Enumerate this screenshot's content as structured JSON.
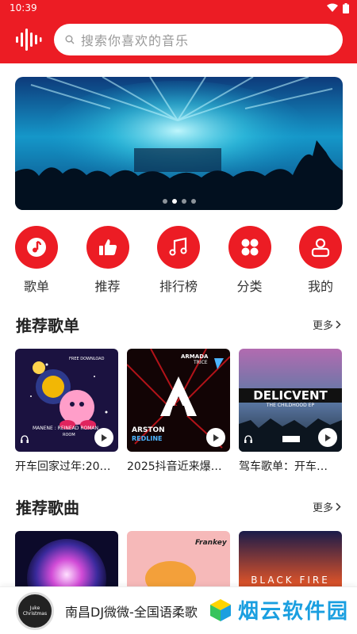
{
  "status": {
    "time": "10:39"
  },
  "header": {
    "search_placeholder": "搜索你喜欢的音乐"
  },
  "banner": {
    "dots": 4,
    "active_dot": 1
  },
  "quick_nav": [
    {
      "label": "歌单",
      "icon": "music-note-icon"
    },
    {
      "label": "推荐",
      "icon": "thumbs-up-icon"
    },
    {
      "label": "排行榜",
      "icon": "music-notes-icon"
    },
    {
      "label": "分类",
      "icon": "category-grid-icon"
    },
    {
      "label": "我的",
      "icon": "user-icon"
    }
  ],
  "playlists": {
    "title": "推荐歌单",
    "more": "更多",
    "items": [
      {
        "title": "开车回家过年:20…",
        "cover_text": "MANENE : REINEAD ROMAN",
        "cover_subtext": "ROOM"
      },
      {
        "title": "2025抖音近来爆…",
        "cover_text": "ARSTON",
        "cover_subtext": "REDLINE",
        "cover_brand": "ARMADA",
        "cover_brand2": "TRICE"
      },
      {
        "title": "驾车歌单：开车…",
        "cover_text": "DELICVENT",
        "cover_subtext": "THE CHILDHOOD EP"
      }
    ]
  },
  "songs": {
    "title": "推荐歌曲",
    "more": "更多",
    "items": [
      {
        "cover_text": ""
      },
      {
        "cover_text": "Frankey"
      },
      {
        "cover_text": "BLACK FIRE"
      }
    ]
  },
  "player": {
    "title": "南昌DJ微微-全国语柔歌",
    "disc_text": "Juke Christmas"
  },
  "watermark": {
    "text": "烟云软件园"
  },
  "colors": {
    "brand": "#ec1c24",
    "watermark": "#1a9fe0"
  }
}
